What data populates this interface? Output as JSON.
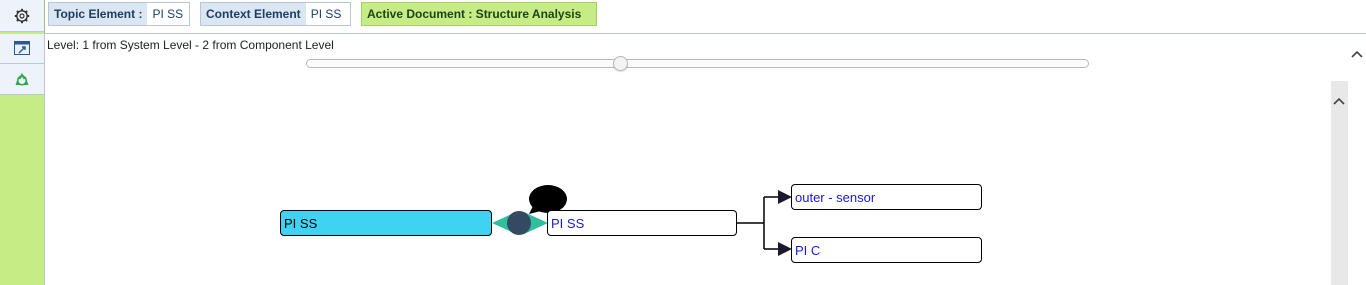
{
  "topic_element": {
    "label": "Topic Element :",
    "value": "PI SS"
  },
  "context_element": {
    "label": "Context Element",
    "value": "PI SS"
  },
  "active_document": {
    "label": "Active Document : Structure Analysis"
  },
  "level": {
    "text": "Level: 1 from System Level - 2 from Component Level"
  },
  "diagram": {
    "topic_node": "PI SS",
    "context_node": "PI SS",
    "children": [
      {
        "label": "outer - sensor"
      },
      {
        "label": "PI C"
      }
    ]
  },
  "icons": {
    "settings": "gear-icon",
    "window": "window-icon",
    "refresh": "recycle-icon",
    "scroll_up": "chevron-up-icon"
  },
  "colors": {
    "sidebar": "#c6ec86",
    "topic_node": "#3fd2f2",
    "connector_arrow": "#2fbf9c",
    "connector_circle": "#344a63",
    "link_text": "#1a1ad6"
  }
}
